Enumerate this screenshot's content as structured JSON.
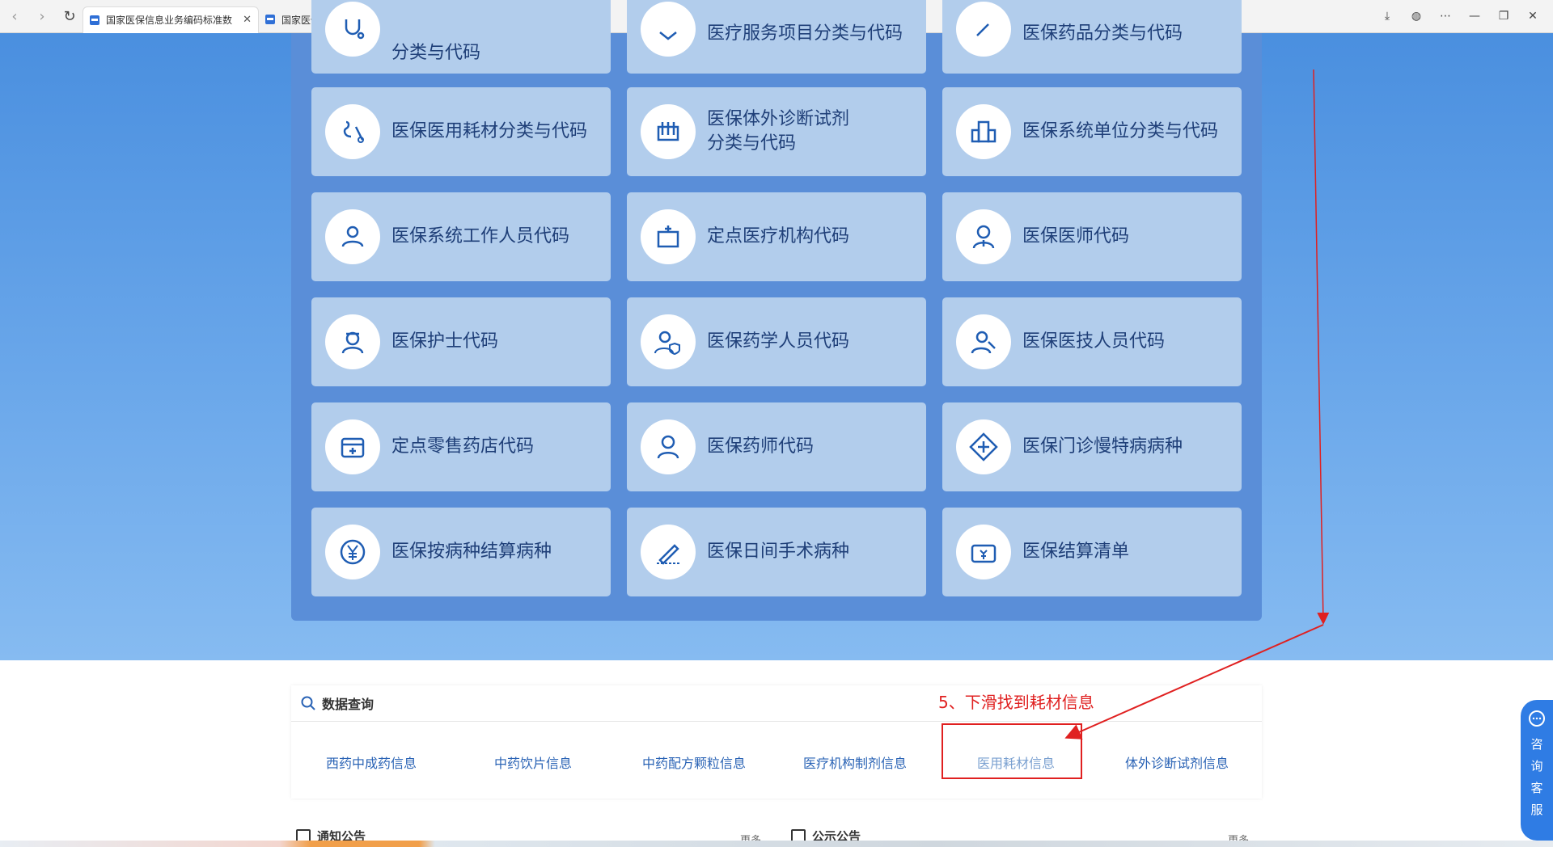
{
  "browser": {
    "tabs": [
      {
        "title": "国家医保信息业务编码标准数",
        "active": true
      },
      {
        "title": "国家医保信息业务编码标准数据库",
        "active": false
      }
    ]
  },
  "top_cards_partial": [
    {
      "label": "分类与代码",
      "icon": "stethoscope-icon"
    },
    {
      "label": "医疗服务项目分类与代码",
      "icon": "heart-shield-icon"
    },
    {
      "label": "医保药品分类与代码",
      "icon": "pill-icon"
    }
  ],
  "cards": [
    {
      "label": "医保医用耗材分类与代码",
      "icon": "surgical-tools-icon"
    },
    {
      "label": "医保体外诊断试剂\n分类与代码",
      "icon": "test-tubes-icon"
    },
    {
      "label": "医保系统单位分类与代码",
      "icon": "building-icon"
    },
    {
      "label": "医保系统工作人员代码",
      "icon": "staff-person-icon"
    },
    {
      "label": "定点医疗机构代码",
      "icon": "hospital-icon"
    },
    {
      "label": "医保医师代码",
      "icon": "doctor-icon"
    },
    {
      "label": "医保护士代码",
      "icon": "nurse-icon"
    },
    {
      "label": "医保药学人员代码",
      "icon": "pharmacist-shield-icon"
    },
    {
      "label": "医保医技人员代码",
      "icon": "technician-icon"
    },
    {
      "label": "定点零售药店代码",
      "icon": "pharmacy-store-icon"
    },
    {
      "label": "医保药师代码",
      "icon": "pharmacist-icon"
    },
    {
      "label": "医保门诊慢特病病种",
      "icon": "medical-cross-icon"
    },
    {
      "label": "医保按病种结算病种",
      "icon": "yuan-coin-icon"
    },
    {
      "label": "医保日间手术病种",
      "icon": "scalpel-icon"
    },
    {
      "label": "医保结算清单",
      "icon": "wallet-yuan-icon"
    }
  ],
  "query": {
    "title": "数据查询",
    "links": [
      "西药中成药信息",
      "中药饮片信息",
      "中药配方颗粒信息",
      "医疗机构制剂信息",
      "医用耗材信息",
      "体外诊断试剂信息"
    ]
  },
  "annotation": {
    "instruction": "5、下滑找到耗材信息"
  },
  "news": {
    "left_title": "通知公告",
    "right_title": "公示公告",
    "more": "更多"
  },
  "consult": {
    "chars": [
      "咨",
      "询",
      "客",
      "服"
    ]
  },
  "colors": {
    "accent": "#2f7ce4",
    "card_bg": "#b2cdec",
    "panel_bg": "#5a8ed8",
    "annotation_red": "#e02020",
    "link_blue": "#2a63b5"
  }
}
